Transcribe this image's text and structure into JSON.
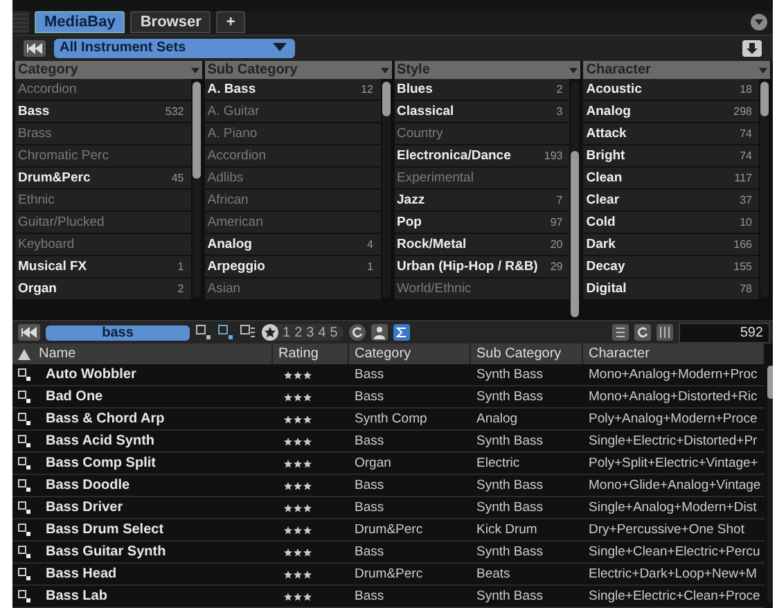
{
  "tabs": [
    {
      "label": "MediaBay",
      "selected": true
    },
    {
      "label": "Browser",
      "selected": false
    },
    {
      "label": "+",
      "selected": false
    }
  ],
  "scope": {
    "value": "All Instrument Sets"
  },
  "filter_columns": [
    {
      "title": "Category",
      "items": [
        {
          "label": "Accordion",
          "enabled": false
        },
        {
          "label": "Bass",
          "count": "532",
          "enabled": true
        },
        {
          "label": "Brass",
          "enabled": false
        },
        {
          "label": "Chromatic Perc",
          "enabled": false
        },
        {
          "label": "Drum&Perc",
          "count": "45",
          "enabled": true
        },
        {
          "label": "Ethnic",
          "enabled": false
        },
        {
          "label": "Guitar/Plucked",
          "enabled": false
        },
        {
          "label": "Keyboard",
          "enabled": false
        },
        {
          "label": "Musical FX",
          "count": "1",
          "enabled": true
        },
        {
          "label": "Organ",
          "count": "2",
          "enabled": true
        }
      ]
    },
    {
      "title": "Sub Category",
      "items": [
        {
          "label": "A. Bass",
          "count": "12",
          "enabled": true
        },
        {
          "label": "A. Guitar",
          "enabled": false
        },
        {
          "label": "A. Piano",
          "enabled": false
        },
        {
          "label": "Accordion",
          "enabled": false
        },
        {
          "label": "Adlibs",
          "enabled": false
        },
        {
          "label": "African",
          "enabled": false
        },
        {
          "label": "American",
          "enabled": false
        },
        {
          "label": "Analog",
          "count": "4",
          "enabled": true
        },
        {
          "label": "Arpeggio",
          "count": "1",
          "enabled": true
        },
        {
          "label": "Asian",
          "enabled": false
        }
      ]
    },
    {
      "title": "Style",
      "items": [
        {
          "label": "Blues",
          "count": "2",
          "enabled": true
        },
        {
          "label": "Classical",
          "count": "3",
          "enabled": true
        },
        {
          "label": "Country",
          "enabled": false
        },
        {
          "label": "Electronica/Dance",
          "count": "193",
          "enabled": true
        },
        {
          "label": "Experimental",
          "enabled": false
        },
        {
          "label": "Jazz",
          "count": "7",
          "enabled": true
        },
        {
          "label": "Pop",
          "count": "97",
          "enabled": true
        },
        {
          "label": "Rock/Metal",
          "count": "20",
          "enabled": true
        },
        {
          "label": "Urban (Hip-Hop / R&B)",
          "count": "29",
          "enabled": true
        },
        {
          "label": "World/Ethnic",
          "enabled": false
        }
      ]
    },
    {
      "title": "Character",
      "items": [
        {
          "label": "Acoustic",
          "count": "18",
          "enabled": true
        },
        {
          "label": "Analog",
          "count": "298",
          "enabled": true
        },
        {
          "label": "Attack",
          "count": "74",
          "enabled": true
        },
        {
          "label": "Bright",
          "count": "74",
          "enabled": true
        },
        {
          "label": "Clean",
          "count": "117",
          "enabled": true
        },
        {
          "label": "Clear",
          "count": "37",
          "enabled": true
        },
        {
          "label": "Cold",
          "count": "10",
          "enabled": true
        },
        {
          "label": "Dark",
          "count": "166",
          "enabled": true
        },
        {
          "label": "Decay",
          "count": "155",
          "enabled": true
        },
        {
          "label": "Digital",
          "count": "78",
          "enabled": true
        }
      ]
    }
  ],
  "search": {
    "value": "bass"
  },
  "rating_filter": [
    "1",
    "2",
    "3",
    "4",
    "5"
  ],
  "result_count": "592",
  "results": {
    "columns": [
      "Name",
      "Rating",
      "Category",
      "Sub Category",
      "Character"
    ],
    "rows": [
      {
        "name": "Auto Wobbler",
        "stars": 3,
        "category": "Bass",
        "sub_category": "Synth Bass",
        "character": "Mono+Analog+Modern+Proc"
      },
      {
        "name": "Bad One",
        "stars": 3,
        "category": "Bass",
        "sub_category": "Synth Bass",
        "character": "Mono+Analog+Distorted+Ric"
      },
      {
        "name": "Bass & Chord Arp",
        "stars": 3,
        "category": "Synth Comp",
        "sub_category": "Analog",
        "character": "Poly+Analog+Modern+Proce"
      },
      {
        "name": "Bass Acid Synth",
        "stars": 3,
        "category": "Bass",
        "sub_category": "Synth Bass",
        "character": "Single+Electric+Distorted+Pr"
      },
      {
        "name": "Bass Comp Split",
        "stars": 3,
        "category": "Organ",
        "sub_category": "Electric",
        "character": "Poly+Split+Electric+Vintage+"
      },
      {
        "name": "Bass Doodle",
        "stars": 3,
        "category": "Bass",
        "sub_category": "Synth Bass",
        "character": "Mono+Glide+Analog+Vintage"
      },
      {
        "name": "Bass Driver",
        "stars": 3,
        "category": "Bass",
        "sub_category": "Synth Bass",
        "character": "Single+Analog+Modern+Dist"
      },
      {
        "name": "Bass Drum Select",
        "stars": 3,
        "category": "Drum&Perc",
        "sub_category": "Kick Drum",
        "character": "Dry+Percussive+One Shot"
      },
      {
        "name": "Bass Guitar Synth",
        "stars": 3,
        "category": "Bass",
        "sub_category": "Synth Bass",
        "character": "Single+Clean+Electric+Percu"
      },
      {
        "name": "Bass Head",
        "stars": 3,
        "category": "Drum&Perc",
        "sub_category": "Beats",
        "character": "Electric+Dark+Loop+New+M"
      },
      {
        "name": "Bass Lab",
        "stars": 3,
        "category": "Bass",
        "sub_category": "Synth Bass",
        "character": "Single+Electric+Clean+Proce"
      }
    ]
  }
}
